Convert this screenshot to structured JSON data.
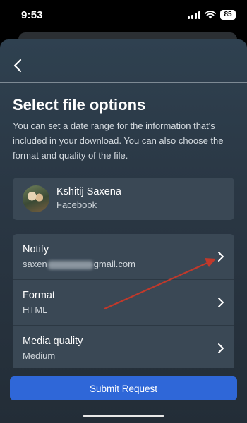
{
  "status_bar": {
    "time": "9:53",
    "battery": "85"
  },
  "header": {
    "back_icon": "chevron-left-icon"
  },
  "page": {
    "title": "Select file options",
    "description": "You can set a date range for the information that's included in your download. You can also choose the format and quality of the file."
  },
  "account": {
    "name": "Kshitij Saxena",
    "platform": "Facebook"
  },
  "options": [
    {
      "label": "Notify",
      "value_prefix": "saxen",
      "value_suffix": "gmail.com"
    },
    {
      "label": "Format",
      "value": "HTML"
    },
    {
      "label": "Media quality",
      "value": "Medium"
    }
  ],
  "submit": {
    "label": "Submit Request"
  },
  "colors": {
    "accent": "#2f67d8",
    "annotation_arrow": "#c0392b"
  }
}
